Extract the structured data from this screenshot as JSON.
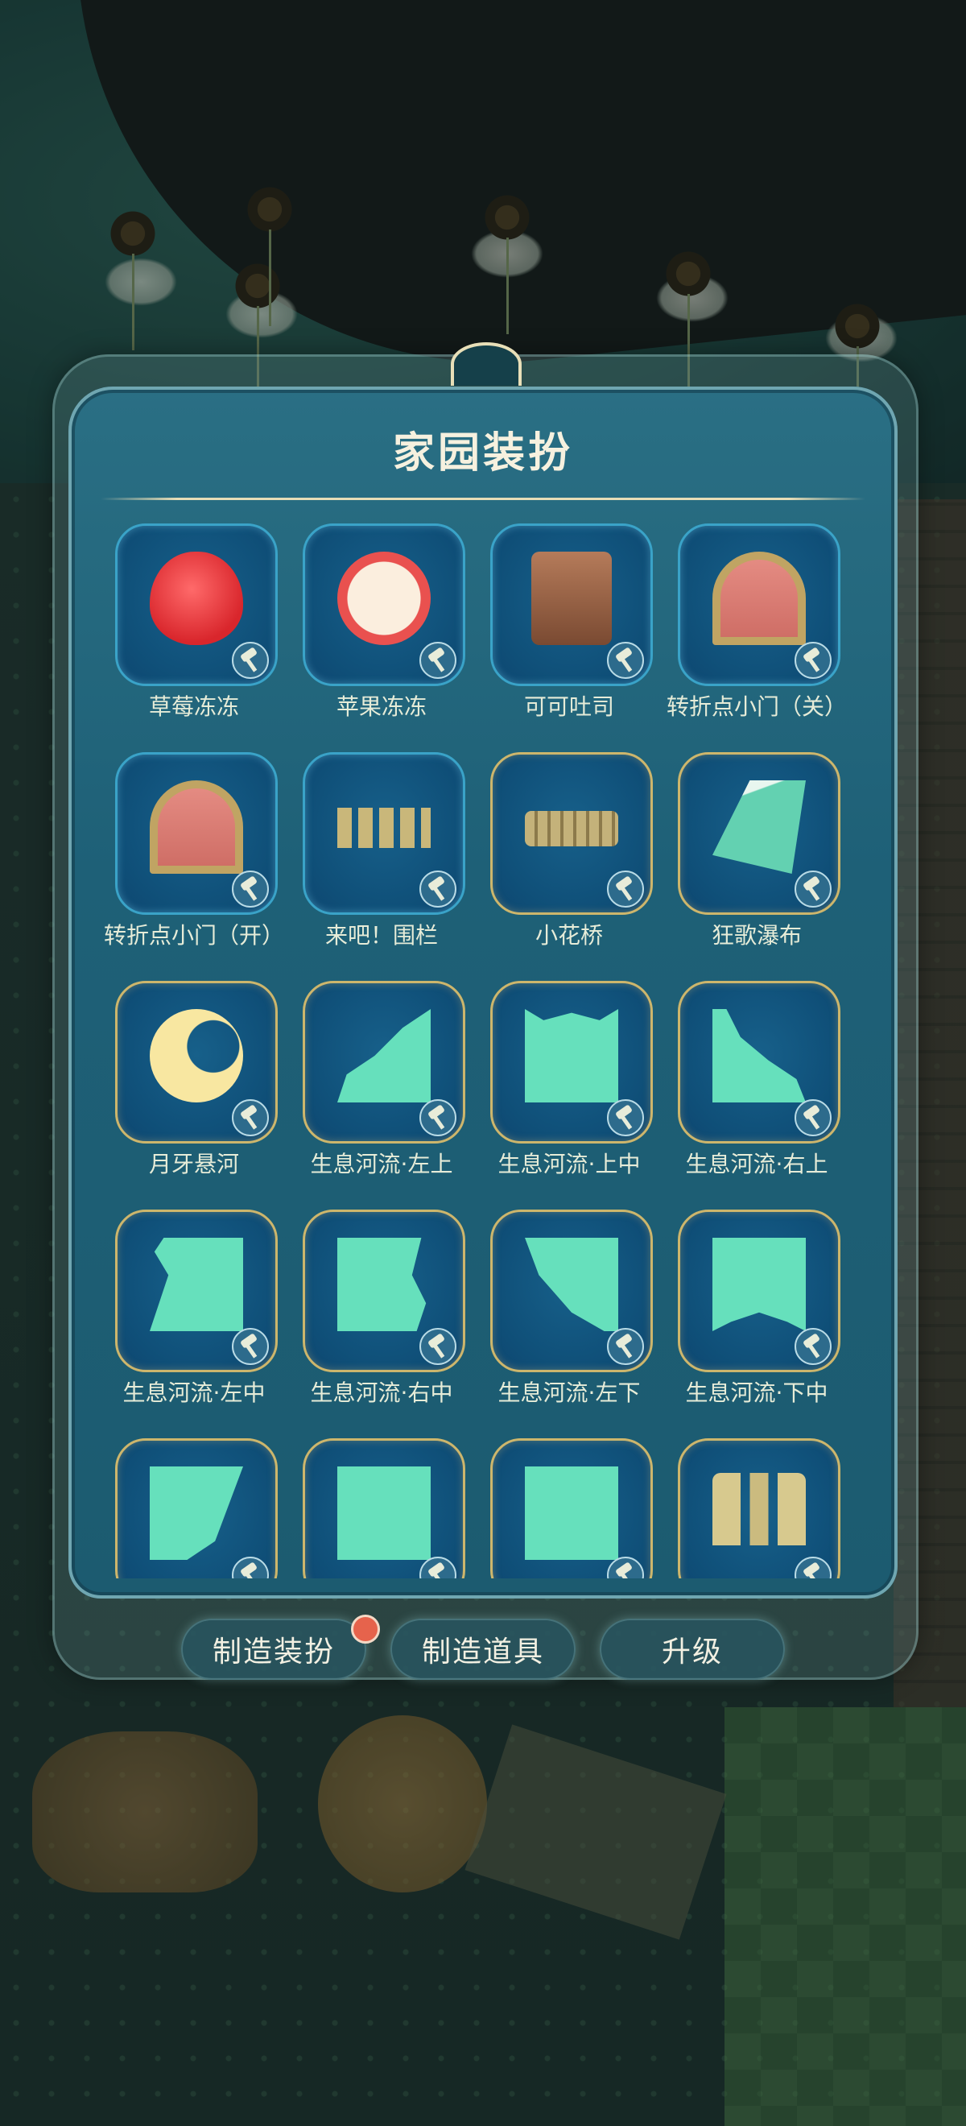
{
  "title": "家园装扮",
  "items": [
    {
      "label": "草莓冻冻",
      "art": "strawberry",
      "frame": "blue"
    },
    {
      "label": "苹果冻冻",
      "art": "apple",
      "frame": "blue"
    },
    {
      "label": "可可吐司",
      "art": "toast",
      "frame": "blue"
    },
    {
      "label": "转折点小门（关）",
      "art": "arch",
      "frame": "blue"
    },
    {
      "label": "转折点小门（开）",
      "art": "arch",
      "frame": "blue"
    },
    {
      "label": "来吧！围栏",
      "art": "fence",
      "frame": "blue"
    },
    {
      "label": "小花桥",
      "art": "bridge",
      "frame": "gold"
    },
    {
      "label": "狂歌瀑布",
      "art": "waterfall",
      "frame": "gold"
    },
    {
      "label": "月牙悬河",
      "art": "moon",
      "frame": "gold"
    },
    {
      "label": "生息河流·左上",
      "art": "water w-tl",
      "frame": "gold"
    },
    {
      "label": "生息河流·上中",
      "art": "water w-tc",
      "frame": "gold"
    },
    {
      "label": "生息河流·右上",
      "art": "water w-tr",
      "frame": "gold"
    },
    {
      "label": "生息河流·左中",
      "art": "water w-ml",
      "frame": "gold"
    },
    {
      "label": "生息河流·右中",
      "art": "water w-mr",
      "frame": "gold"
    },
    {
      "label": "生息河流·左下",
      "art": "water w-bl",
      "frame": "gold"
    },
    {
      "label": "生息河流·下中",
      "art": "water w-bc",
      "frame": "gold"
    },
    {
      "label": "",
      "art": "water w-r5a",
      "frame": "gold"
    },
    {
      "label": "",
      "art": "water",
      "frame": "gold"
    },
    {
      "label": "",
      "art": "water",
      "frame": "gold"
    },
    {
      "label": "",
      "art": "stumps",
      "frame": "gold"
    }
  ],
  "buttons": {
    "craft_decor": "制造装扮",
    "craft_tools": "制造道具",
    "upgrade": "升级"
  },
  "colors": {
    "panel": "#1e6077",
    "tile": "#0f4f78",
    "water": "#66e0bc",
    "badge": "#e6634c"
  }
}
